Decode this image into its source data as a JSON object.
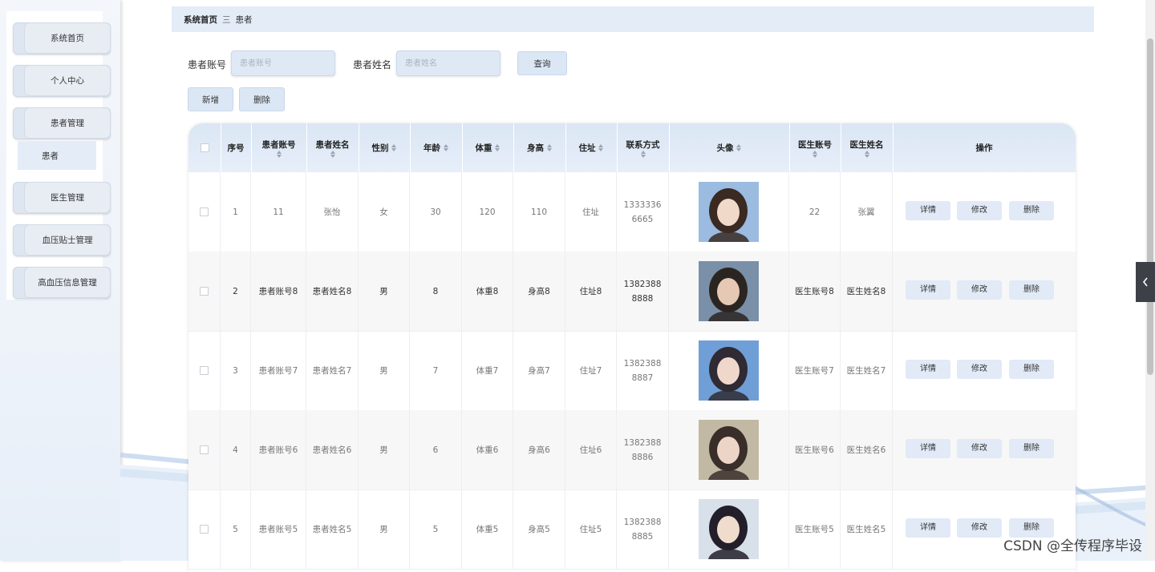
{
  "sidebar": {
    "items": [
      {
        "label": "系统首页"
      },
      {
        "label": "个人中心"
      },
      {
        "label": "患者管理"
      },
      {
        "label": "医生管理"
      },
      {
        "label": "血压贴士管理"
      },
      {
        "label": "高血压信息管理"
      }
    ],
    "sub_item": "患者"
  },
  "breadcrumb": {
    "home": "系统首页",
    "separator": "三",
    "current": "患者"
  },
  "search": {
    "account_label": "患者账号",
    "account_placeholder": "患者账号",
    "name_label": "患者姓名",
    "name_placeholder": "患者姓名",
    "query_label": "查询"
  },
  "actions": {
    "add_label": "新增",
    "delete_label": "删除"
  },
  "table": {
    "headers": [
      "序号",
      "患者账号",
      "患者姓名",
      "性别",
      "年龄",
      "体重",
      "身高",
      "住址",
      "联系方式",
      "头像",
      "医生账号",
      "医生姓名",
      "操作"
    ],
    "row_actions": {
      "detail": "详情",
      "edit": "修改",
      "delete": "删除"
    },
    "rows": [
      {
        "index": "1",
        "account": "11",
        "name": "张怡",
        "gender": "女",
        "age": "30",
        "weight": "120",
        "height": "110",
        "address": "住址",
        "phone_1": "1333336",
        "phone_2": "6665",
        "doctor_account": "22",
        "doctor_name": "张翼"
      },
      {
        "index": "2",
        "account": "患者账号8",
        "name": "患者姓名8",
        "gender": "男",
        "age": "8",
        "weight": "体重8",
        "height": "身高8",
        "address": "住址8",
        "phone_1": "1382388",
        "phone_2": "8888",
        "doctor_account": "医生账号8",
        "doctor_name": "医生姓名8"
      },
      {
        "index": "3",
        "account": "患者账号7",
        "name": "患者姓名7",
        "gender": "男",
        "age": "7",
        "weight": "体重7",
        "height": "身高7",
        "address": "住址7",
        "phone_1": "1382388",
        "phone_2": "8887",
        "doctor_account": "医生账号7",
        "doctor_name": "医生姓名7"
      },
      {
        "index": "4",
        "account": "患者账号6",
        "name": "患者姓名6",
        "gender": "男",
        "age": "6",
        "weight": "体重6",
        "height": "身高6",
        "address": "住址6",
        "phone_1": "1382388",
        "phone_2": "8886",
        "doctor_account": "医生账号6",
        "doctor_name": "医生姓名6"
      },
      {
        "index": "5",
        "account": "患者账号5",
        "name": "患者姓名5",
        "gender": "男",
        "age": "5",
        "weight": "体重5",
        "height": "身高5",
        "address": "住址5",
        "phone_1": "1382388",
        "phone_2": "8885",
        "doctor_account": "医生账号5",
        "doctor_name": "医生姓名5"
      }
    ]
  },
  "watermark": "CSDN @全传程序毕设",
  "colors": {
    "accent": "#dce7f5",
    "header_bg": "#e3ecf7",
    "sidebar_bg": "#eef3fa"
  }
}
